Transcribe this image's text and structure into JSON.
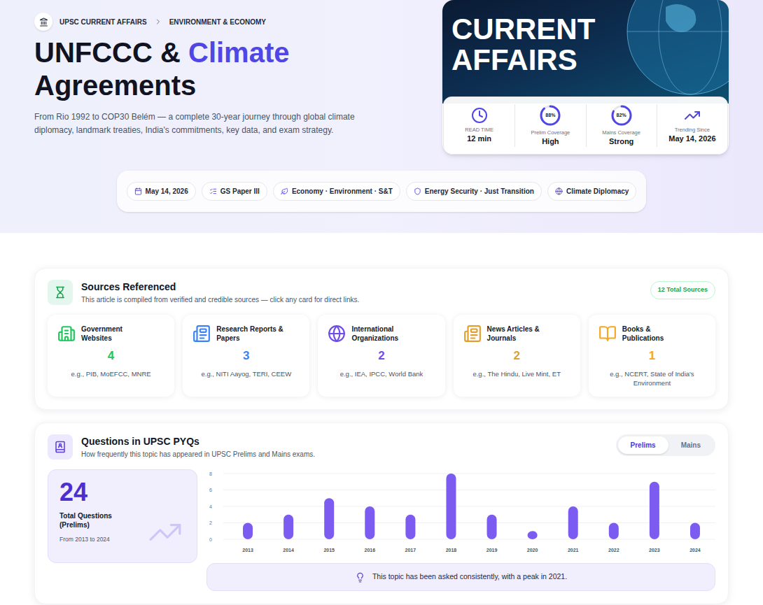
{
  "breadcrumb": [
    "UPSC CURRENT AFFAIRS",
    "ENVIRONMENT & ECONOMY"
  ],
  "title": [
    {
      "text": "UNFCCC &",
      "highlight": false
    },
    {
      "text": "Climate",
      "highlight": true
    },
    {
      "text": "Agreements",
      "highlight": false
    }
  ],
  "description": "From Rio 1992 to COP30 Belém — a complete 30-year journey through global climate diplomacy, landmark treaties, India's commitments, key data, and exam strategy.",
  "banner": {
    "lines": [
      "CURRENT",
      "AFFAIRS"
    ]
  },
  "stats": [
    {
      "kind": "clock",
      "label": "READ TIME",
      "value": "12 min"
    },
    {
      "kind": "ring",
      "label": "Prelim Coverage",
      "value": "High",
      "reading": "88%",
      "level": 0.88
    },
    {
      "kind": "ring",
      "label": "Mains Coverage",
      "value": "Strong",
      "reading": "82%",
      "level": 0.82
    },
    {
      "kind": "trend",
      "label": "Trending Since",
      "value": "May 14, 2026"
    }
  ],
  "tags": [
    "May 14, 2026",
    "GS Paper III",
    "Economy · Environment · S&T",
    "Energy Security · Just Transition",
    "Climate Diplomacy"
  ],
  "sources": {
    "title": "Sources Referenced",
    "subtitle": "This article is compiled from verified and credible sources — click any card for direct links.",
    "badge": "12 Total Sources",
    "items": [
      {
        "label": "Government Websites",
        "count": "4",
        "examples": "e.g., PIB, MoEFCC, MNRE",
        "color": "#22c55e"
      },
      {
        "label": "Research Reports & Papers",
        "count": "3",
        "examples": "e.g., NITI Aayog, TERI, CEEW",
        "color": "#3b82f6"
      },
      {
        "label": "International Organizations",
        "count": "2",
        "examples": "e.g., IEA, IPCC, World Bank",
        "color": "#6d4ee8"
      },
      {
        "label": "News Articles & Journals",
        "count": "2",
        "examples": "e.g., The Hindu, Live Mint, ET",
        "color": "#e0a030"
      },
      {
        "label": "Books & Publications",
        "count": "1",
        "examples": "e.g., NCERT, State of India's Environment",
        "color": "#f5a623"
      }
    ]
  },
  "pyq": {
    "title": "Questions in UPSC PYQs",
    "subtitle": "How frequently this topic has appeared in UPSC Prelims and Mains exams.",
    "tabs": [
      {
        "label": "Prelims",
        "selected": true
      },
      {
        "label": "Mains",
        "selected": false
      }
    ],
    "total": "24",
    "total_label": "Total Questions (Prelims)",
    "range": "From 2013 to 2024",
    "chart": {
      "y_ticks": [
        "0",
        "2",
        "4",
        "6",
        "8"
      ],
      "years": [
        "2013",
        "2014",
        "2015",
        "2016",
        "2017",
        "2018",
        "2019",
        "2020",
        "2021",
        "2022",
        "2023",
        "2024"
      ],
      "values": [
        2,
        3,
        5,
        4,
        3,
        8,
        3,
        1,
        4,
        2,
        7,
        2
      ]
    },
    "insight": "This topic has been asked consistently, with a peak in 2021."
  }
}
